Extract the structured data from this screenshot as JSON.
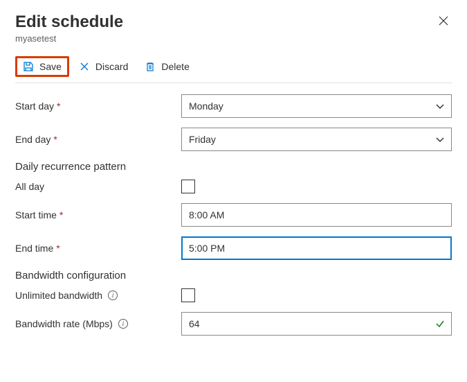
{
  "header": {
    "title": "Edit schedule",
    "subtitle": "myasetest"
  },
  "toolbar": {
    "save_label": "Save",
    "discard_label": "Discard",
    "delete_label": "Delete"
  },
  "form": {
    "start_day_label": "Start day",
    "start_day_value": "Monday",
    "end_day_label": "End day",
    "end_day_value": "Friday",
    "recurrence_header": "Daily recurrence pattern",
    "all_day_label": "All day",
    "start_time_label": "Start time",
    "start_time_value": "8:00 AM",
    "end_time_label": "End time",
    "end_time_value": "5:00 PM",
    "bandwidth_header": "Bandwidth configuration",
    "unlimited_label": "Unlimited bandwidth",
    "rate_label": "Bandwidth rate (Mbps)",
    "rate_value": "64"
  }
}
